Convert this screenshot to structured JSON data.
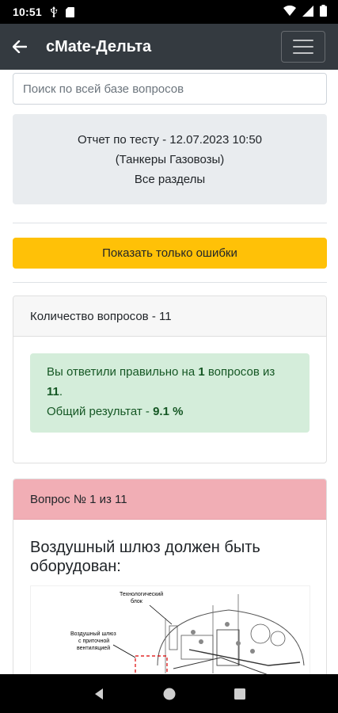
{
  "status_bar": {
    "time": "10:51"
  },
  "app_bar": {
    "title": "cMate-Дельта"
  },
  "search": {
    "placeholder": "Поиск по всей базе вопросов"
  },
  "report": {
    "line1": "Отчет по тесту - 12.07.2023 10:50",
    "line2": "(Танкеры Газовозы)",
    "line3": "Все разделы"
  },
  "errors_button": {
    "label": "Показать только ошибки"
  },
  "summary": {
    "header": "Количество вопросов - 11",
    "text_prefix": "Вы ответили правильно на ",
    "correct": "1",
    "text_mid": " вопросов из ",
    "total": "11",
    "text_end": ".",
    "result_label": "Общий результат - ",
    "result_value": "9.1 %"
  },
  "question": {
    "header": "Вопрос № 1 из 11",
    "text": "Воздушный шлюз должен быть оборудован:",
    "image_labels": {
      "label1_line1": "Технологический",
      "label1_line2": "блок",
      "label2_line1": "Воздушный шлюз",
      "label2_line2": "с приточной",
      "label2_line3": "вентиляцией"
    }
  },
  "colors": {
    "app_bar": "#343a40",
    "warning_button": "#ffc107",
    "success_alert": "#d4edda",
    "danger_header": "#f1aeb5"
  },
  "icons": [
    "back-arrow-icon",
    "menu-icon",
    "usb-icon",
    "sd-card-icon",
    "wifi-icon",
    "signal-icon",
    "battery-icon",
    "nav-back-icon",
    "nav-home-icon",
    "nav-recents-icon"
  ]
}
